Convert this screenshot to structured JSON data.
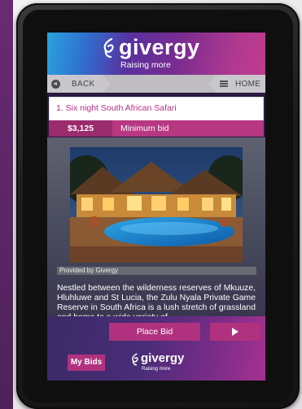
{
  "header": {
    "logo_text": "givergy",
    "tagline": "Raising more"
  },
  "nav": {
    "back_label": "BACK",
    "home_label": "HOME"
  },
  "lot": {
    "title": "1. Six night South African Safari",
    "bid_amount": "$3,125",
    "bid_label": "Minimum bid"
  },
  "image": {
    "caption": "Provided by Givergy"
  },
  "description": "Nestled between the wilderness reserves of Mkuuze, Hluhluwe and St Lucia, the Zulu Nyala Private Game Reserve in South Africa is a lush stretch of grassland and home to a wide variety of",
  "actions": {
    "place_bid_label": "Place Bid",
    "my_bids_label": "My Bids"
  },
  "footer": {
    "logo_text": "givergy",
    "tagline": "Raising more"
  },
  "colors": {
    "brand_magenta": "#b0327f",
    "lot_title": "#b82c83",
    "banner_blue": "#29a3de",
    "banner_purple": "#7a2c8f"
  }
}
